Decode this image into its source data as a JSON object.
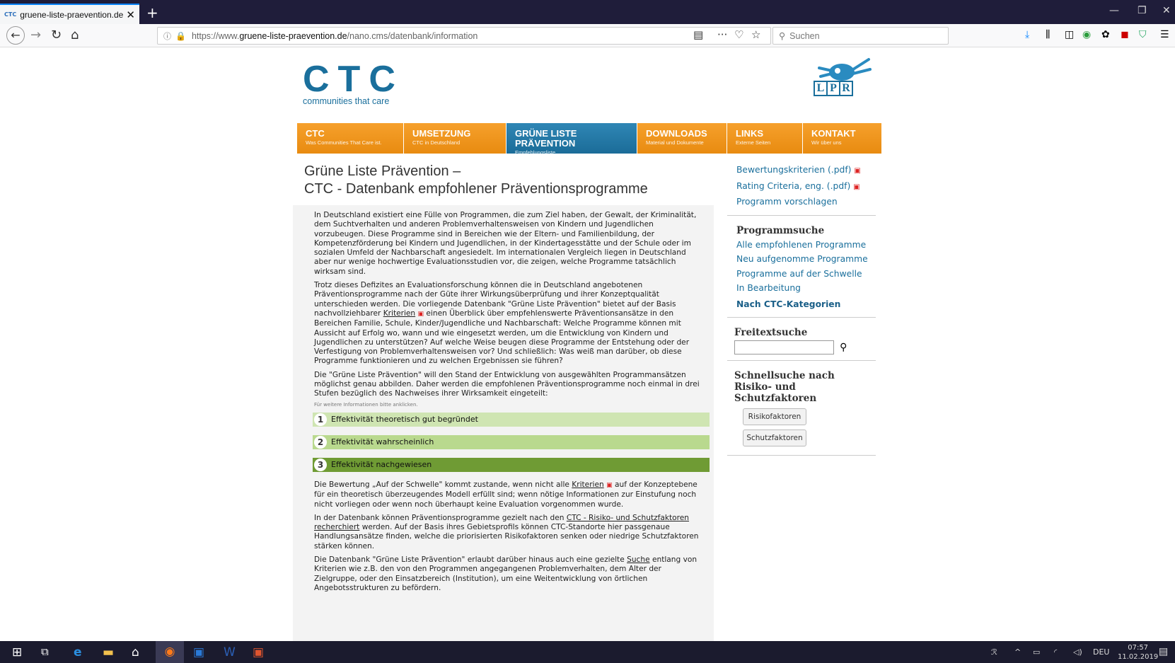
{
  "browser": {
    "tab_title": "gruene-liste-praevention.de/na",
    "tab_favicon": "CTC",
    "url_prefix": "https://www.",
    "url_domain": "gruene-liste-praevention.de",
    "url_path": "/nano.cms/datenbank/information",
    "search_placeholder": "Suchen"
  },
  "logo": {
    "big": "CTC",
    "small": "communities that care",
    "lpr": [
      "L",
      "P",
      "R"
    ]
  },
  "menu": [
    {
      "label": "CTC",
      "sub": "Was Communities That Care ist."
    },
    {
      "label": "UMSETZUNG",
      "sub": "CTC in Deutschland"
    },
    {
      "label": "GRÜNE LISTE PRÄVENTION",
      "sub": "Empfehlungsliste"
    },
    {
      "label": "DOWNLOADS",
      "sub": "Material und Dokumente"
    },
    {
      "label": "LINKS",
      "sub": "Externe Seiten"
    },
    {
      "label": "KONTAKT",
      "sub": "Wir über uns"
    }
  ],
  "main": {
    "title1": "Grüne Liste Prävention –",
    "title2": "CTC - Datenbank empfohlener Präventionsprogramme",
    "p1": "In Deutschland existiert eine Fülle von Programmen, die zum Ziel haben, der Gewalt, der Kriminalität, dem Suchtverhalten und anderen Problemverhaltensweisen von Kindern und Jugendlichen vorzubeugen. Diese Programme sind in Bereichen wie der Eltern- und Familienbildung, der Kompetenzförderung bei Kindern und Jugendlichen, in der Kindertagesstätte und der Schule oder im sozialen Umfeld der Nachbarschaft angesiedelt. Im internationalen Vergleich liegen in Deutschland aber nur wenige hochwertige Evaluationsstudien vor, die zeigen, welche Programme tatsächlich wirksam sind.",
    "p2a": "Trotz dieses Defizites an Evaluationsforschung können die in Deutschland angebotenen Präventionsprogramme nach der Güte ihrer Wirkungsüberprüfung und ihrer Konzeptqualität unterschieden werden. Die vorliegende Datenbank \"Grüne Liste Prävention\" bietet auf der Basis nachvollziehbarer ",
    "p2link": "Kriterien",
    "p2b": " einen Überblick über empfehlenswerte Präventionsansätze in den Bereichen Familie, Schule, Kinder/Jugendliche und Nachbarschaft: Welche Programme können mit Aussicht auf Erfolg wo, wann und wie eingesetzt werden, um die Entwicklung von Kindern und Jugendlichen zu unterstützen? Auf welche Weise beugen diese Programme der Entstehung oder der Verfestigung von Problemverhaltensweisen vor? Und schließlich: Was weiß man darüber, ob diese Programme funktionieren und zu welchen Ergebnissen sie führen?",
    "p3": "Die \"Grüne Liste Prävention\" will den Stand der Entwicklung von ausgewählten Programmansätzen möglichst genau abbilden. Daher werden die empfohlenen Präventionsprogramme noch einmal in drei Stufen bezüglich des Nachweises ihrer Wirksamkeit eingeteilt:",
    "hint": "Für weitere Informationen bitte anklicken.",
    "stufen": [
      {
        "num": "1",
        "label": "Effektivität theoretisch gut begründet"
      },
      {
        "num": "2",
        "label": "Effektivität wahrscheinlich"
      },
      {
        "num": "3",
        "label": "Effektivität nachgewiesen"
      }
    ],
    "p4a": "Die Bewertung „Auf der Schwelle\" kommt zustande, wenn nicht alle ",
    "p4link": "Kriterien",
    "p4b": " auf der Konzeptebene für ein theoretisch überzeugendes Modell erfüllt sind; wenn nötige Informationen zur Einstufung noch nicht vorliegen oder wenn noch überhaupt keine Evaluation vorgenommen wurde.",
    "p5a": "In der Datenbank können Präventionsprogramme gezielt nach den ",
    "p5link": "CTC - Risiko- und Schutzfaktoren recherchiert",
    "p5b": " werden. Auf der Basis ihres Gebietsprofils können CTC-Standorte hier passgenaue Handlungsansätze finden, welche die priorisierten Risikofaktoren senken oder niedrige Schutzfaktoren stärken können.",
    "p6a": "Die Datenbank \"Grüne Liste Prävention\" erlaubt darüber hinaus auch eine gezielte ",
    "p6link": "Suche",
    "p6b": " entlang von Kriterien wie z.B. den von den Programmen angegangenen Problemverhalten, dem Alter der Zielgruppe, oder den Einsatzbereich (Institution), um eine Weitentwicklung von örtlichen Angebotsstrukturen zu befördern."
  },
  "sidebar": {
    "links1": [
      "Bewertungskriterien (.pdf)",
      "Rating Criteria, eng. (.pdf)",
      "Programm vorschlagen"
    ],
    "prog_heading": "Programmsuche",
    "prog_links": [
      "Alle empfohlenen Programme",
      "Neu aufgenomme Programme",
      "Programme auf der Schwelle",
      "In Bearbeitung"
    ],
    "ctc_link": "Nach CTC-Kategorien",
    "free_heading": "Freitextsuche",
    "quick_heading": "Schnellsuche nach Risiko- und Schutzfaktoren",
    "btn_risk": "Risikofaktoren",
    "btn_protect": "Schutzfaktoren"
  },
  "taskbar": {
    "lang": "DEU",
    "time": "07:57",
    "date": "11.02.2019"
  },
  "colors": {
    "brand_blue": "#1a6f9c",
    "menu_orange": "#f6a02c",
    "menu_active": "#2f86b5"
  }
}
